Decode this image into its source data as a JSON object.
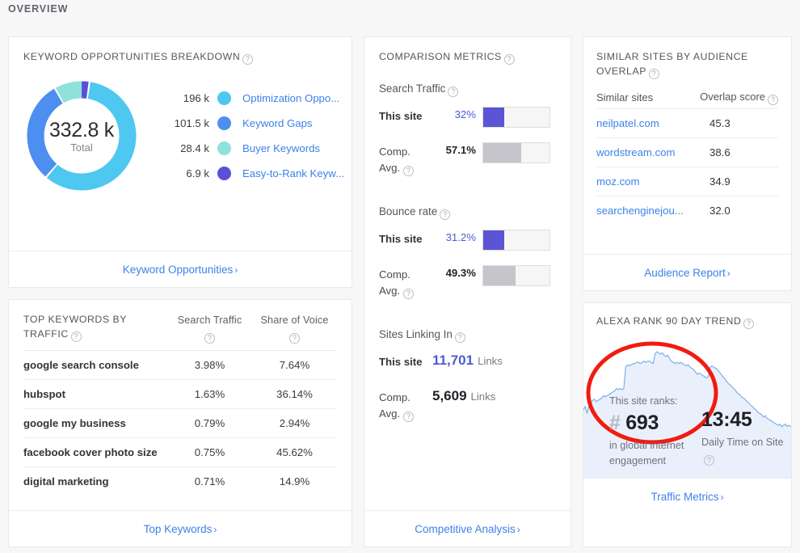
{
  "page": {
    "title": "OVERVIEW"
  },
  "colors": {
    "link": "#3d82e8",
    "purple": "#5b55d6",
    "gray_bar": "#c5c5cb",
    "annotation_red": "#f21b0f",
    "seg_optimization": "#4ec8f0",
    "seg_gaps": "#4d8ef0",
    "seg_buyer": "#8fe2da",
    "seg_easy": "#5b4fd6"
  },
  "keyword_breakdown": {
    "title": "KEYWORD OPPORTUNITIES BREAKDOWN",
    "help": "?",
    "total_value": "332.8 k",
    "total_label": "Total",
    "legend": [
      {
        "value": "196 k",
        "label": "Optimization Oppo...",
        "color": "#4ec8f0"
      },
      {
        "value": "101.5 k",
        "label": "Keyword Gaps",
        "color": "#4d8ef0"
      },
      {
        "value": "28.4 k",
        "label": "Buyer Keywords",
        "color": "#8fe2da"
      },
      {
        "value": "6.9 k",
        "label": "Easy-to-Rank Keyw...",
        "color": "#5b4fd6"
      }
    ],
    "footer_link": "Keyword Opportunities",
    "chevron": "›"
  },
  "chart_data": {
    "type": "pie",
    "title": "KEYWORD OPPORTUNITIES BREAKDOWN",
    "legend_position": "right",
    "total": 332800,
    "total_display": "332.8 k",
    "categories": [
      "Optimization Oppo...",
      "Keyword Gaps",
      "Buyer Keywords",
      "Easy-to-Rank Keyw..."
    ],
    "values": [
      196000,
      101500,
      28400,
      6900
    ],
    "value_labels": [
      "196 k",
      "101.5 k",
      "28.4 k",
      "6.9 k"
    ],
    "colors": [
      "#4ec8f0",
      "#4d8ef0",
      "#8fe2da",
      "#5b4fd6"
    ]
  },
  "top_keywords": {
    "title": "TOP KEYWORDS BY TRAFFIC",
    "help": "?",
    "columns": [
      "Search Traffic",
      "Share of Voice"
    ],
    "rows": [
      {
        "keyword": "google search console",
        "search_traffic": "3.98%",
        "share_of_voice": "7.64%"
      },
      {
        "keyword": "hubspot",
        "search_traffic": "1.63%",
        "share_of_voice": "36.14%"
      },
      {
        "keyword": "google my business",
        "search_traffic": "0.79%",
        "share_of_voice": "2.94%"
      },
      {
        "keyword": "facebook cover photo size",
        "search_traffic": "0.75%",
        "share_of_voice": "45.62%"
      },
      {
        "keyword": "digital marketing",
        "search_traffic": "0.71%",
        "share_of_voice": "14.9%"
      }
    ],
    "footer_link": "Top Keywords",
    "chevron": "›"
  },
  "comparison": {
    "title": "COMPARISON METRICS",
    "this_site_label": "This site",
    "comp_avg_label": "Comp. Avg.",
    "groups": [
      {
        "name": "Search Traffic",
        "this_site": {
          "value": "32%",
          "pct": 32
        },
        "comp_avg": {
          "value": "57.1%",
          "pct": 57.1
        }
      },
      {
        "name": "Bounce rate",
        "this_site": {
          "value": "31.2%",
          "pct": 31.2
        },
        "comp_avg": {
          "value": "49.3%",
          "pct": 49.3
        }
      }
    ],
    "links_group": {
      "name": "Sites Linking In",
      "this_site": {
        "value": "11,701",
        "unit": "Links"
      },
      "comp_avg": {
        "value": "5,609",
        "unit": "Links"
      }
    },
    "footer_link": "Competitive Analysis",
    "chevron": "›"
  },
  "similar_sites": {
    "title": "SIMILAR SITES BY AUDIENCE OVERLAP",
    "col_sites": "Similar sites",
    "col_score": "Overlap score",
    "rows": [
      {
        "site": "neilpatel.com",
        "score": "45.3"
      },
      {
        "site": "wordstream.com",
        "score": "38.6"
      },
      {
        "site": "moz.com",
        "score": "34.9"
      },
      {
        "site": "searchenginejou...",
        "score": "32.0"
      }
    ],
    "footer_link": "Audience Report",
    "chevron": "›"
  },
  "alexa": {
    "title": "ALEXA RANK 90 DAY TREND",
    "rank_caption": "This site ranks:",
    "rank_hash": "#",
    "rank_value": "693",
    "rank_sub": "in global internet engagement",
    "time_value": "13:45",
    "time_sub": "Daily Time on Site",
    "footer_link": "Traffic Metrics",
    "chevron": "›",
    "sparkline": [
      52,
      49,
      55,
      48,
      46,
      44,
      43,
      45,
      44,
      43,
      42,
      40,
      41,
      40,
      39,
      38,
      37,
      36,
      34,
      35,
      34,
      35,
      34,
      16,
      14,
      15,
      14,
      13,
      13,
      12,
      12,
      13,
      12,
      11,
      12,
      11,
      11,
      12,
      13,
      5,
      3,
      4,
      5,
      4,
      6,
      7,
      6,
      9,
      11,
      12,
      13,
      12,
      13,
      12,
      13,
      14,
      15,
      14,
      16,
      17,
      18,
      20,
      22,
      21,
      22,
      23,
      24,
      25,
      24,
      16,
      15,
      16,
      17,
      18,
      20,
      22,
      24,
      26,
      28,
      30,
      31,
      33,
      34,
      36,
      38,
      39,
      41,
      42,
      43,
      45,
      46,
      48,
      49,
      51,
      52,
      54,
      55,
      56,
      58,
      57,
      59,
      60,
      61,
      62,
      63,
      64,
      65,
      64,
      66,
      65,
      64,
      66,
      65,
      66,
      67
    ]
  }
}
